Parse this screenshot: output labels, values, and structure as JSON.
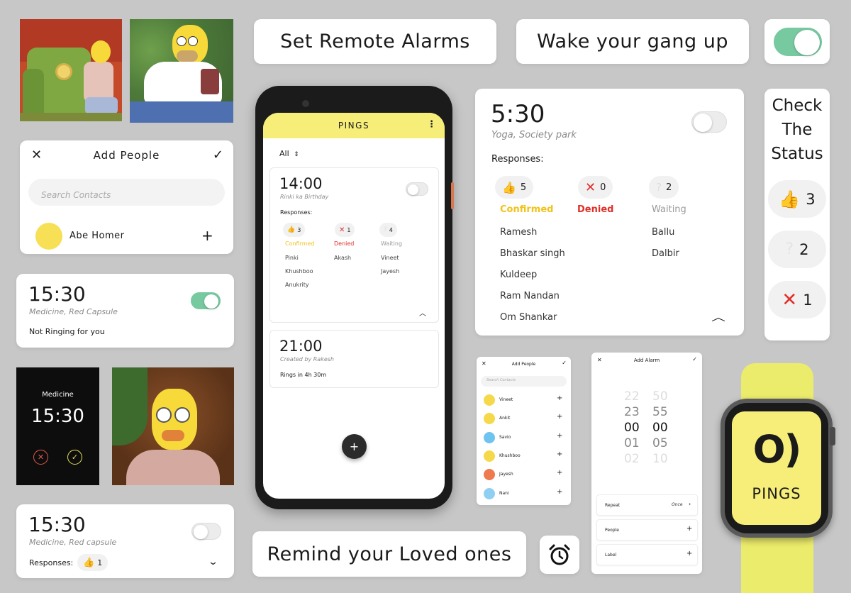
{
  "colors": {
    "accent_yellow": "#f7ee7a",
    "toggle_on": "#77c9a0",
    "confirmed": "#f2c21a",
    "denied": "#e0302a",
    "waiting": "#9a9a9a",
    "bg": "#c7c7c7"
  },
  "taglines": {
    "set_remote": "Set Remote Alarms",
    "wake_gang": "Wake your gang up",
    "remind": "Remind your Loved ones",
    "check_status": [
      "Check",
      "The",
      "Status"
    ]
  },
  "add_people_card": {
    "title": "Add People",
    "search_placeholder": "Search Contacts",
    "contact_name": "Abe Homer"
  },
  "alarm_card_1": {
    "time": "15:30",
    "desc": "Medicine,  Red Capsule",
    "status": "Not Ringing for you",
    "toggle": "on"
  },
  "ring_screen": {
    "label": "Medicine",
    "time": "15:30"
  },
  "alarm_card_2": {
    "time": "15:30",
    "desc": "Medicine,  Red capsule",
    "responses_label": "Responses:",
    "count": "1"
  },
  "phone": {
    "app_title": "PINGS",
    "filter": "All",
    "alarm1": {
      "time": "14:00",
      "desc": "Rinki ka Birthday",
      "responses_label": "Responses:",
      "confirmed": {
        "count": "3",
        "label": "Confirmed",
        "names": [
          "Pinki",
          "Khushboo",
          "Anukrity"
        ]
      },
      "denied": {
        "count": "1",
        "label": "Denied",
        "names": [
          "Akash"
        ]
      },
      "waiting": {
        "count": "4",
        "label": "Waiting",
        "names": [
          "Vineet",
          "Jayesh"
        ]
      }
    },
    "alarm2": {
      "time": "21:00",
      "desc": "Created by  Rakesh",
      "status": "Rings in 4h 30m"
    },
    "fab": "+"
  },
  "big_card": {
    "time": "5:30",
    "desc": "Yoga, Society park",
    "responses_label": "Responses:",
    "confirmed": {
      "count": "5",
      "label": "Confirmed",
      "names": [
        "Ramesh",
        "Bhaskar singh",
        "Kuldeep",
        "Ram Nandan",
        "Om Shankar"
      ]
    },
    "denied": {
      "count": "0",
      "label": "Denied"
    },
    "waiting": {
      "count": "2",
      "label": "Waiting",
      "names": [
        "Ballu",
        "Dalbir"
      ]
    }
  },
  "status_pills": {
    "confirmed": "3",
    "waiting": "2",
    "denied": "1"
  },
  "small_add_people": {
    "title": "Add People",
    "search_placeholder": "Search Contacts",
    "contacts": [
      {
        "name": "Vineet",
        "color": "#f5d94a"
      },
      {
        "name": "Ankit",
        "color": "#f5d94a"
      },
      {
        "name": "Savio",
        "color": "#6fc3ef"
      },
      {
        "name": "Khushboo",
        "color": "#f5d94a"
      },
      {
        "name": "Jayesh",
        "color": "#ee7a4f"
      },
      {
        "name": "Nani",
        "color": "#8fd0f2"
      }
    ]
  },
  "add_alarm": {
    "title": "Add Alarm",
    "hours": [
      "22",
      "23",
      "00",
      "01",
      "02"
    ],
    "minutes": [
      "50",
      "55",
      "00",
      "05",
      "10"
    ],
    "repeat_label": "Repeat",
    "repeat_value": "Once",
    "people_label": "People",
    "label_label": "Label"
  },
  "watch": {
    "logo": "O)",
    "brand": "PINGS"
  }
}
